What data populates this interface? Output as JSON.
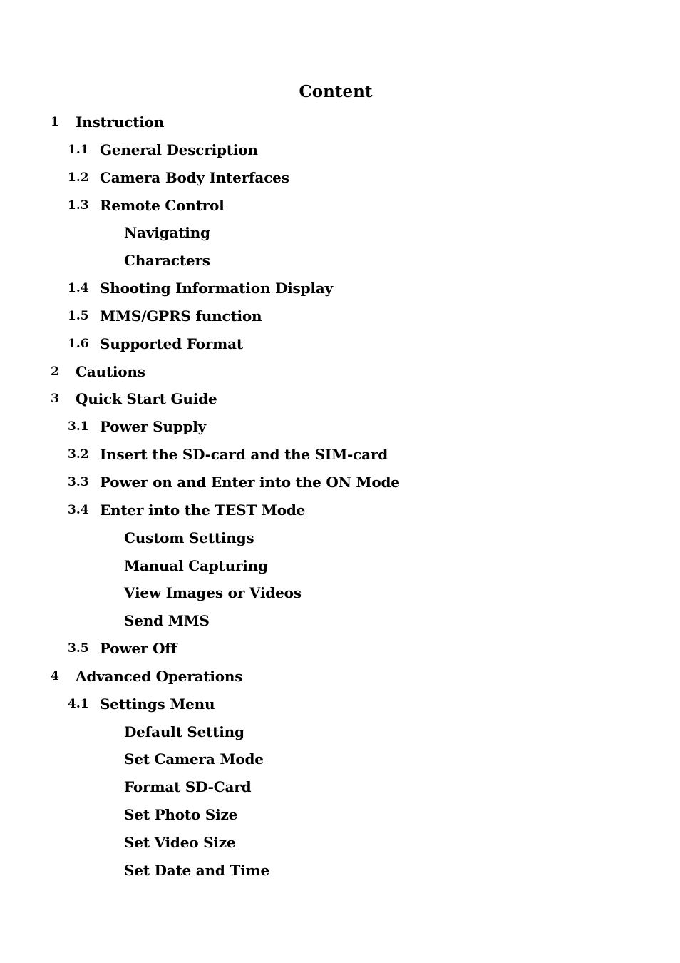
{
  "document": {
    "title": "Content",
    "entries": [
      {
        "level": 1,
        "number": "1",
        "label": "Instruction"
      },
      {
        "level": 2,
        "number": "1.1",
        "label": "General Description"
      },
      {
        "level": 2,
        "number": "1.2",
        "label": "Camera Body Interfaces"
      },
      {
        "level": 2,
        "number": "1.3",
        "label": "Remote Control"
      },
      {
        "level": 3,
        "number": "",
        "label": "Navigating"
      },
      {
        "level": 3,
        "number": "",
        "label": "Characters"
      },
      {
        "level": 2,
        "number": "1.4",
        "label": "Shooting Information Display"
      },
      {
        "level": 2,
        "number": "1.5",
        "label": "MMS/GPRS function"
      },
      {
        "level": 2,
        "number": "1.6",
        "label": "Supported Format"
      },
      {
        "level": 1,
        "number": "2",
        "label": "Cautions"
      },
      {
        "level": 1,
        "number": "3",
        "label": "Quick Start Guide"
      },
      {
        "level": 2,
        "number": "3.1",
        "label": "Power Supply"
      },
      {
        "level": 2,
        "number": "3.2",
        "label": "Insert the SD-card and the SIM-card"
      },
      {
        "level": 2,
        "number": "3.3",
        "label": "Power on and Enter into the ON Mode"
      },
      {
        "level": 2,
        "number": "3.4",
        "label": "Enter into the TEST Mode"
      },
      {
        "level": 3,
        "number": "",
        "label": "Custom Settings"
      },
      {
        "level": 3,
        "number": "",
        "label": "Manual Capturing"
      },
      {
        "level": 3,
        "number": "",
        "label": "View Images or Videos"
      },
      {
        "level": 3,
        "number": "",
        "label": "Send MMS"
      },
      {
        "level": 2,
        "number": "3.5",
        "label": "Power Off"
      },
      {
        "level": 1,
        "number": "4",
        "label": "Advanced Operations"
      },
      {
        "level": 2,
        "number": "4.1",
        "label": "Settings Menu"
      },
      {
        "level": 3,
        "number": "",
        "label": "Default Setting"
      },
      {
        "level": 3,
        "number": "",
        "label": "Set Camera Mode"
      },
      {
        "level": 3,
        "number": "",
        "label": "Format SD-Card"
      },
      {
        "level": 3,
        "number": "",
        "label": "Set Photo Size"
      },
      {
        "level": 3,
        "number": "",
        "label": "Set Video Size"
      },
      {
        "level": 3,
        "number": "",
        "label": "Set Date and Time"
      }
    ]
  }
}
